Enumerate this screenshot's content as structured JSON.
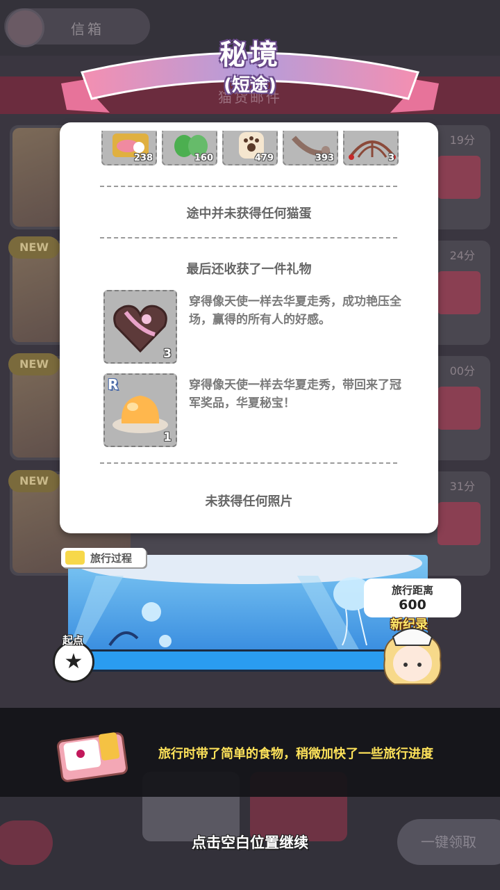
{
  "background": {
    "mailbox_label": "信箱",
    "section_title": "猫货邮件",
    "new_badge": "NEW",
    "card_times": [
      "19分",
      "24分",
      "00分",
      "31分"
    ],
    "claim_all_label": "一键领取"
  },
  "title": {
    "main": "秘境",
    "sub": "(短途)"
  },
  "results": {
    "items": [
      {
        "icon": "canned-fish-icon",
        "count": "238"
      },
      {
        "icon": "mint-leaves-icon",
        "count": "160"
      },
      {
        "icon": "paw-biscuit-icon",
        "count": "479"
      },
      {
        "icon": "fish-bone-icon",
        "count": "393"
      },
      {
        "icon": "web-ornament-icon",
        "count": "3"
      }
    ],
    "no_egg_text": "途中并未获得任何猫蛋",
    "gift_heading": "最后还收获了一件礼物",
    "gifts": [
      {
        "icon": "heart-chocolate-box-icon",
        "count": "3",
        "rarity": "",
        "description": "穿得像天使一样去华夏走秀，成功艳压全场，赢得的所有人的好感。"
      },
      {
        "icon": "jelly-pudding-icon",
        "count": "1",
        "rarity": "R",
        "description": "穿得像天使一样去华夏走秀，带回来了冠军奖品，华夏秘宝！"
      }
    ],
    "no_photo_text": "未获得任何照片"
  },
  "travel": {
    "section_label": "旅行过程",
    "start_label": "起点",
    "start_icon": "star-icon",
    "distance_label": "旅行距离",
    "distance_value": "600",
    "record_label": "新纪录",
    "progress_fraction": 1.0
  },
  "message": {
    "text": "旅行时带了简单的食物，稍微加快了一些旅行进度",
    "continue_hint": "点击空白位置继续"
  },
  "colors": {
    "highlight_yellow": "#ffe35a",
    "progress_blue": "#1f6fc4",
    "ribbon_pink": "#f48fb1",
    "ribbon_purple": "#b39ddb"
  }
}
